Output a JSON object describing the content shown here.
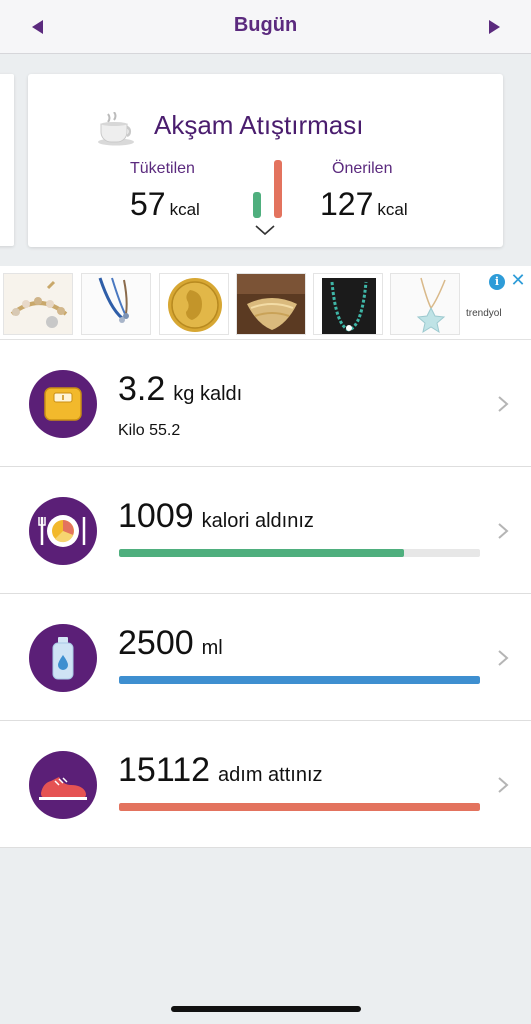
{
  "header": {
    "title": "Bugün",
    "prev_icon": "triangle-left-icon",
    "next_icon": "triangle-right-icon"
  },
  "meal": {
    "title": "Akşam Atıştırması",
    "icon": "teacup-icon",
    "consumed_label": "Tüketilen",
    "consumed_value": "57",
    "consumed_unit": "kcal",
    "recommended_label": "Önerilen",
    "recommended_value": "127",
    "recommended_unit": "kcal",
    "bar_consumed": 57,
    "bar_recommended": 127,
    "colors": {
      "consumed": "#4faf7e",
      "recommended": "#e3735e"
    },
    "expand_icon": "chevron-down-icon"
  },
  "ad": {
    "brand": "trendyol",
    "info_icon": "info-icon",
    "info_glyph": "i",
    "close_icon": "close-icon",
    "close_glyph": "✕",
    "products": [
      {
        "icon": "bracelet-image"
      },
      {
        "icon": "necklace-image"
      },
      {
        "icon": "gold-coin-image"
      },
      {
        "icon": "gold-chain-image"
      },
      {
        "icon": "bead-necklace-image"
      },
      {
        "icon": "star-pendant-image"
      }
    ]
  },
  "rows": {
    "weight": {
      "value": "3.2",
      "suffix": "kg kaldı",
      "sub": "Kilo 55.2",
      "icon": "scale-icon"
    },
    "calories": {
      "value": "1009",
      "suffix": "kalori aldınız",
      "progress": 0.79,
      "color": "#4faf7e",
      "icon": "plate-icon"
    },
    "water": {
      "value": "2500",
      "suffix": "ml",
      "progress": 1.0,
      "color": "#3e8fd0",
      "icon": "water-bottle-icon"
    },
    "steps": {
      "value": "15112",
      "suffix": "adım attınız",
      "progress": 1.0,
      "color": "#e3735e",
      "icon": "sneaker-icon"
    }
  }
}
